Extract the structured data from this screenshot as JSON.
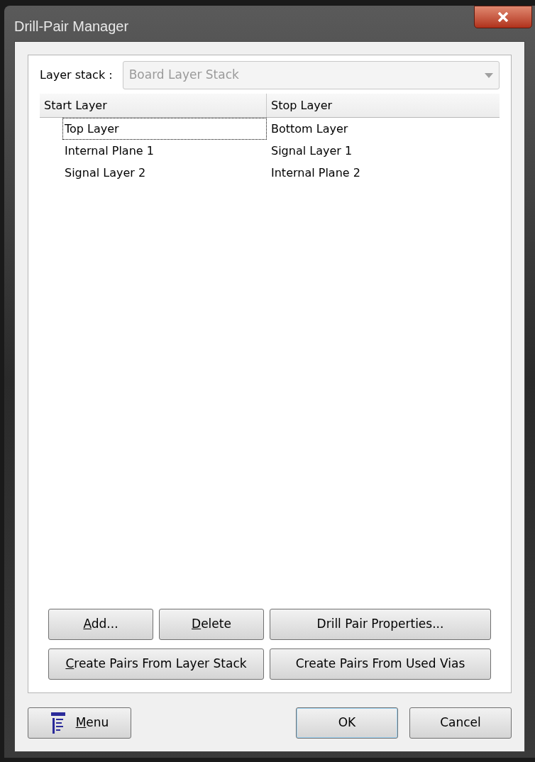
{
  "window": {
    "title": "Drill-Pair Manager"
  },
  "layer_stack": {
    "label": "Layer stack :",
    "value": "Board Layer Stack",
    "disabled": true
  },
  "table": {
    "columns": [
      "Start Layer",
      "Stop Layer"
    ],
    "rows": [
      {
        "start": "Top Layer",
        "stop": "Bottom Layer",
        "focused": true
      },
      {
        "start": "Internal Plane 1",
        "stop": "Signal Layer 1",
        "focused": false
      },
      {
        "start": "Signal Layer 2",
        "stop": "Internal Plane 2",
        "focused": false
      }
    ]
  },
  "actions": [
    {
      "label": "Add...",
      "mnemonic": true
    },
    {
      "label": "Delete",
      "mnemonic": true
    },
    {
      "label": "Drill Pair Properties...",
      "mnemonic": false
    },
    {
      "label": "Create Pairs From Layer Stack",
      "mnemonic": true
    },
    {
      "label": "Create Pairs From Used Vias",
      "mnemonic": false
    }
  ],
  "footer": {
    "menu": {
      "label": "Menu",
      "mnemonic": true
    },
    "buttons": [
      {
        "label": "OK",
        "default": true
      },
      {
        "label": "Cancel",
        "default": false
      }
    ]
  }
}
